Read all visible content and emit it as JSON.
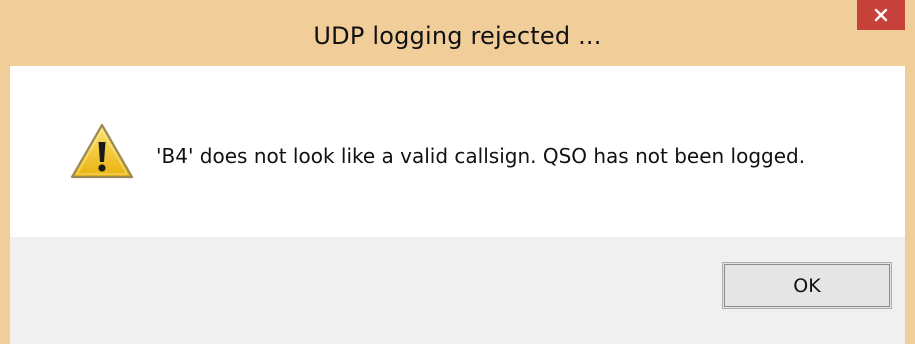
{
  "window": {
    "title": "UDP logging rejected ..."
  },
  "dialog": {
    "icon": "warning-icon",
    "message": "'B4' does not look like a valid callsign.  QSO has not been logged."
  },
  "buttons": {
    "ok_label": "OK",
    "close_icon": "close-icon"
  },
  "colors": {
    "titlebar": "#f1cd9a",
    "close_button": "#c7413b",
    "button_bar": "#f0f0f0",
    "warning_yellow": "#f3c81e"
  }
}
